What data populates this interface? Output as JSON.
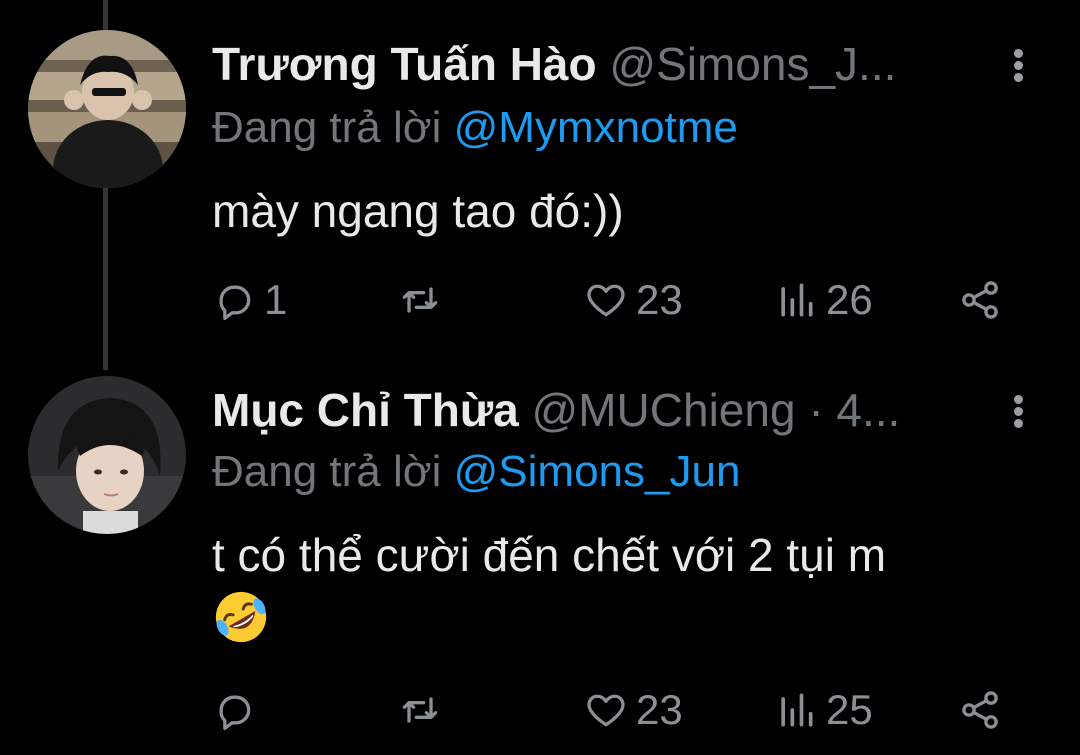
{
  "tweets": [
    {
      "display_name": "Trương Tuấn Hào",
      "handle": "@Simons_J...",
      "reply_prefix": "Đang trả lời",
      "reply_to": "@Mymxnotme",
      "text": "mày ngang tao đó:))",
      "reply_count": "1",
      "retweet_count": "",
      "like_count": "23",
      "view_count": "26"
    },
    {
      "display_name": "Mục Chỉ Thừa",
      "handle": "@MUChieng · 4...",
      "reply_prefix": "Đang trả lời",
      "reply_to": "@Simons_Jun",
      "text": "t có thể cười đến chết với 2 tụi m",
      "emoji": "rolling-on-floor-laughing",
      "reply_count": "",
      "retweet_count": "",
      "like_count": "23",
      "view_count": "25"
    }
  ],
  "colors": {
    "background": "#000000",
    "text": "#e7e9ea",
    "secondary": "#71767b",
    "mention": "#1d9bf0",
    "thread_line": "#333639"
  }
}
